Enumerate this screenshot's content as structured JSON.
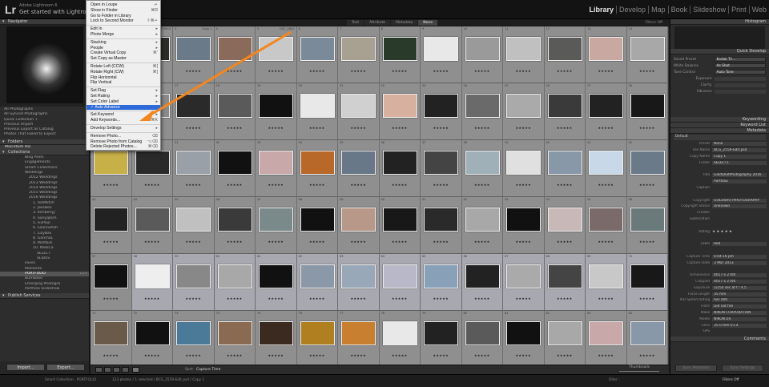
{
  "app": {
    "subtitle": "Adobe Lightroom 6",
    "title": "Get started with Lightroom m",
    "logo": "Lr"
  },
  "modules": [
    "Library",
    "Develop",
    "Map",
    "Book",
    "Slideshow",
    "Print",
    "Web"
  ],
  "left": {
    "navigator": "Navigator",
    "catalog": [
      {
        "label": "All Photographs",
        "count": ""
      },
      {
        "label": "All Synced Photographs",
        "count": ""
      },
      {
        "label": "Quick Collection +",
        "count": ""
      },
      {
        "label": "Previous Import",
        "count": ""
      },
      {
        "label": "Previous Export as Catalog",
        "count": ""
      },
      {
        "label": "Photos That Failed to Export",
        "count": ""
      }
    ],
    "folders": "Folders",
    "drive": "Macintosh HD",
    "collections": "Collections",
    "tree": [
      "Blog Posts",
      "Engagements",
      "Smart Collections",
      "Weddings",
      "2012 Weddings",
      "2013 Weddings",
      "2014 Weddings",
      "2015 Weddings",
      "2016 Weddings",
      "1. AshMitch",
      "2. JessBen",
      "3. KimberlyJ",
      "4. SonyaJosh",
      "5. FixPaul",
      "6. LeanneAsh",
      "7. LizyBas",
      "8. GarimaL",
      "9. MirMark",
      "10. MiekCa",
      "SELECT",
      "SLIDES",
      "Faves",
      "Moments",
      "PORTFOLIO",
      "BurnBase",
      "Emerging Photogra",
      "Portfolio Slideshow"
    ],
    "portfolio_count": "123",
    "publish": "Publish Services",
    "import": "Import...",
    "export": "Export..."
  },
  "grid": {
    "filters": [
      "Text",
      "Attribute",
      "Metadata",
      "None"
    ],
    "filters_off": "Filters Off",
    "stars": "★★★★★",
    "cells": [
      {
        "n": "1",
        "f": "_DSF2802",
        "c": "#c8b8a8"
      },
      {
        "n": "2",
        "f": "_DSF2803",
        "c": "#2c2c28"
      },
      {
        "n": "3",
        "f": "Copy 1",
        "c": "#6a7a88"
      },
      {
        "n": "4",
        "f": "",
        "c": "#8a6a5a"
      },
      {
        "n": "5",
        "f": "DSC_2800",
        "c": "#c8c8c8"
      },
      {
        "n": "6",
        "f": "",
        "c": "#7a8a98"
      },
      {
        "n": "7",
        "f": "",
        "c": "#a8a090"
      },
      {
        "n": "8",
        "f": "",
        "c": "#2a3a2a"
      },
      {
        "n": "9",
        "f": "",
        "c": "#e8e8e8"
      },
      {
        "n": "10",
        "f": "",
        "c": "#9a9a9a"
      },
      {
        "n": "11",
        "f": "",
        "c": "#c0c0c0"
      },
      {
        "n": "12",
        "f": "",
        "c": "#5a5a58"
      },
      {
        "n": "13",
        "f": "",
        "c": "#c8a8a0"
      },
      {
        "n": "14",
        "f": "",
        "c": "#a8a8a8"
      },
      {
        "n": "15",
        "f": "",
        "c": "#d8c8b8"
      },
      {
        "n": "16",
        "f": "",
        "c": "#8a8a8a"
      },
      {
        "n": "17",
        "f": "",
        "c": "#2a2a2a"
      },
      {
        "n": "18",
        "f": "",
        "c": "#5a5a5a"
      },
      {
        "n": "19",
        "f": "",
        "c": "#111"
      },
      {
        "n": "20",
        "f": "",
        "c": "#e8e8e8"
      },
      {
        "n": "21",
        "f": "",
        "c": "#d0d0d0"
      },
      {
        "n": "22",
        "f": "",
        "c": "#d8b0a0"
      },
      {
        "n": "23",
        "f": "",
        "c": "#222"
      },
      {
        "n": "24",
        "f": "",
        "c": "#6a6a6a"
      },
      {
        "n": "25",
        "f": "",
        "c": "#aaa"
      },
      {
        "n": "26",
        "f": "",
        "c": "#3a3a3a"
      },
      {
        "n": "27",
        "f": "",
        "c": "#222"
      },
      {
        "n": "28",
        "f": "",
        "c": "#181818"
      },
      {
        "n": "29",
        "f": "",
        "c": "#c8b048"
      },
      {
        "n": "30",
        "f": "",
        "c": "#2a2a2a"
      },
      {
        "n": "31",
        "f": "",
        "c": "#9aa0a8"
      },
      {
        "n": "32",
        "f": "",
        "c": "#111"
      },
      {
        "n": "33",
        "f": "",
        "c": "#c8a8a8"
      },
      {
        "n": "34",
        "f": "",
        "c": "#b86828"
      },
      {
        "n": "35",
        "f": "",
        "c": "#687888"
      },
      {
        "n": "36",
        "f": "",
        "c": "#222"
      },
      {
        "n": "37",
        "f": "",
        "c": "#444"
      },
      {
        "n": "38",
        "f": "",
        "c": "#a0b0b8"
      },
      {
        "n": "39",
        "f": "",
        "c": "#e0e0e0"
      },
      {
        "n": "40",
        "f": "",
        "c": "#8898a8"
      },
      {
        "n": "41",
        "f": "",
        "c": "#c8d8e8"
      },
      {
        "n": "42",
        "f": "",
        "c": "#6a7a88"
      },
      {
        "n": "43",
        "f": "",
        "c": "#222"
      },
      {
        "n": "44",
        "f": "",
        "c": "#5a5a5a"
      },
      {
        "n": "45",
        "f": "",
        "c": "#c0c0c0"
      },
      {
        "n": "46",
        "f": "",
        "c": "#3a3a3a"
      },
      {
        "n": "47",
        "f": "",
        "c": "#7a8a8a"
      },
      {
        "n": "48",
        "f": "",
        "c": "#111"
      },
      {
        "n": "49",
        "f": "",
        "c": "#b89888"
      },
      {
        "n": "50",
        "f": "",
        "c": "#181818"
      },
      {
        "n": "51",
        "f": "",
        "c": "#2a2a2a"
      },
      {
        "n": "52",
        "f": "",
        "c": "#a8a8a8"
      },
      {
        "n": "53",
        "f": "",
        "c": "#111"
      },
      {
        "n": "54",
        "f": "",
        "c": "#c8b8b8"
      },
      {
        "n": "55",
        "f": "",
        "c": "#7a6a6a"
      },
      {
        "n": "56",
        "f": "",
        "c": "#6a7a7a"
      },
      {
        "n": "57",
        "f": "",
        "c": "#111"
      },
      {
        "n": "58",
        "f": "",
        "c": "#eee"
      },
      {
        "n": "59",
        "f": "",
        "c": "#888"
      },
      {
        "n": "60",
        "f": "",
        "c": "#a8a8a8"
      },
      {
        "n": "61",
        "f": "",
        "c": "#111"
      },
      {
        "n": "62",
        "f": "",
        "c": "#8a98a8"
      },
      {
        "n": "63",
        "f": "",
        "c": "#98a8b8"
      },
      {
        "n": "64",
        "f": "",
        "c": "#b8b8c8"
      },
      {
        "n": "65",
        "f": "",
        "c": "#88a0b8"
      },
      {
        "n": "66",
        "f": "",
        "c": "#222"
      },
      {
        "n": "67",
        "f": "",
        "c": "#aaa"
      },
      {
        "n": "68",
        "f": "",
        "c": "#444"
      },
      {
        "n": "69",
        "f": "",
        "c": "#c8c8c8"
      },
      {
        "n": "70",
        "f": "",
        "c": "#181818"
      },
      {
        "n": "71",
        "f": "",
        "c": "#6a5a4a"
      },
      {
        "n": "72",
        "f": "",
        "c": "#111"
      },
      {
        "n": "73",
        "f": "",
        "c": "#4a7a98"
      },
      {
        "n": "74",
        "f": "",
        "c": "#8a6a50"
      },
      {
        "n": "75",
        "f": "",
        "c": "#3a2a20"
      },
      {
        "n": "76",
        "f": "",
        "c": "#b08020"
      },
      {
        "n": "77",
        "f": "",
        "c": "#c88030"
      },
      {
        "n": "78",
        "f": "",
        "c": "#e8e8e8"
      },
      {
        "n": "79",
        "f": "",
        "c": "#222"
      },
      {
        "n": "80",
        "f": "",
        "c": "#5a5a5a"
      },
      {
        "n": "81",
        "f": "",
        "c": "#111"
      },
      {
        "n": "82",
        "f": "",
        "c": "#a8a8a8"
      },
      {
        "n": "83",
        "f": "",
        "c": "#c8a8a8"
      },
      {
        "n": "84",
        "f": "",
        "c": "#8898a8"
      }
    ]
  },
  "menu": [
    {
      "l": "Open in Loupe",
      "s": "↵"
    },
    {
      "l": "Show in Finder",
      "s": "⌘R"
    },
    {
      "l": "Go to Folder in Library",
      "s": ""
    },
    {
      "l": "Lock to Second Monitor",
      "s": "⇧⌘↵"
    },
    {
      "sep": true
    },
    {
      "l": "Edit In",
      "s": "▸"
    },
    {
      "l": "Photo Merge",
      "s": "▸"
    },
    {
      "sep": true
    },
    {
      "l": "Stacking",
      "s": "▸"
    },
    {
      "l": "People",
      "s": "▸"
    },
    {
      "l": "Create Virtual Copy",
      "s": "⌘'"
    },
    {
      "l": "Set Copy as Master",
      "s": ""
    },
    {
      "sep": true
    },
    {
      "l": "Rotate Left (CCW)",
      "s": "⌘["
    },
    {
      "l": "Rotate Right (CW)",
      "s": "⌘]"
    },
    {
      "l": "Flip Horizontal",
      "s": ""
    },
    {
      "l": "Flip Vertical",
      "s": ""
    },
    {
      "sep": true
    },
    {
      "l": "Set Flag",
      "s": "▸"
    },
    {
      "l": "Set Rating",
      "s": "▸"
    },
    {
      "l": "Set Color Label",
      "s": "▸"
    },
    {
      "l": "✓ Auto Advance",
      "s": "",
      "act": true
    },
    {
      "sep": true
    },
    {
      "l": "Set Keyword",
      "s": "▸"
    },
    {
      "l": "Add Keywords...",
      "s": "⌘K"
    },
    {
      "sep": true
    },
    {
      "l": "Develop Settings",
      "s": "▸"
    },
    {
      "sep": true
    },
    {
      "l": "Remove Photo...",
      "s": "⌫"
    },
    {
      "l": "Remove Photo from Catalog",
      "s": "⌥⌫"
    },
    {
      "l": "Delete Rejected Photos...",
      "s": "⌘⌫"
    }
  ],
  "right": {
    "histogram": "Histogram",
    "quick": "Quick Develop",
    "saved_preset": "Saved Preset",
    "preset_val": "Kodak Tri...",
    "wb": "White Balance",
    "wb_val": "As Shot",
    "tone": "Tone Control",
    "tone_val": "Auto Tone",
    "exposure": "Exposure",
    "clarity": "Clarity",
    "vibrance": "Vibrance",
    "keywording": "Keywording",
    "keyword_list": "Keyword List",
    "metadata": "Metadata",
    "default": "Default",
    "meta": [
      [
        "Preset",
        "None"
      ],
      [
        "File Name",
        "BCG_2559-Edit.psd"
      ],
      [
        "Copy Name",
        "Copy 1"
      ],
      [
        "Folder",
        "SELECT1"
      ],
      [
        "",
        ""
      ],
      [
        "Title",
        "GoldShotPhotography 2016"
      ],
      [
        "",
        "Portfolio"
      ],
      [
        "Caption",
        ""
      ],
      [
        "",
        ""
      ],
      [
        "Copyright",
        "GOLDSHOTPHOTOGRAPHY"
      ],
      [
        "Copyright Status",
        "Unknown"
      ],
      [
        "Creator",
        ""
      ],
      [
        "Sublocation",
        ""
      ],
      [
        "",
        ""
      ],
      [
        "Rating",
        "★ ★ ★ ★ ★"
      ],
      [
        "",
        ""
      ],
      [
        "Label",
        "Red"
      ],
      [
        "",
        ""
      ],
      [
        "Capture Time",
        "6:04:16 pm"
      ],
      [
        "Capture Date",
        "3 Mar 2013"
      ],
      [
        "",
        ""
      ],
      [
        "Dimensions",
        "4017 x 2700"
      ],
      [
        "Cropped",
        "4017 x 2700"
      ],
      [
        "Exposure",
        "1/250 sec at f / 4.5"
      ],
      [
        "Focal Length",
        "35 mm"
      ],
      [
        "ISO Speed Rating",
        "ISO 400"
      ],
      [
        "Flash",
        "Did not fire"
      ],
      [
        "Make",
        "NIKON CORPORATION"
      ],
      [
        "Model",
        "NIKON D4"
      ],
      [
        "Lens",
        "35.0 mm f/1.4"
      ],
      [
        "GPS",
        ""
      ]
    ],
    "comments": "Comments",
    "sync_meta": "Sync Metadata",
    "sync_settings": "Sync Settings"
  },
  "toolbar": {
    "sort_label": "Sort:",
    "sort": "Capture Time",
    "thumbnails": "Thumbnails"
  },
  "filmstrip": {
    "path": "Smart Collection : PORTFOLIO",
    "info": "123 photos / 1 selected / BCG_2559-Edit.psd / Copy 1",
    "filter": "Filter :",
    "filters_off": "Filters Off"
  }
}
